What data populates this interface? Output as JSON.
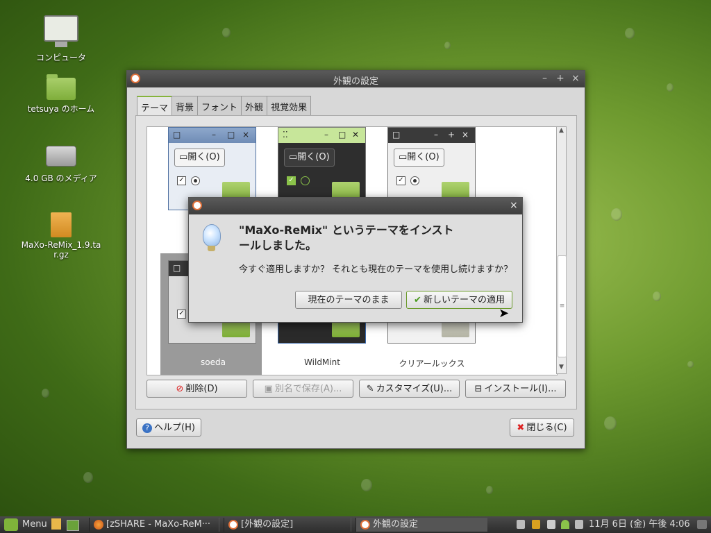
{
  "desktop": {
    "icons": [
      {
        "label": "コンピュータ"
      },
      {
        "label": "tetsuya のホーム"
      },
      {
        "label": "4.0 GB のメディア"
      },
      {
        "label": "MaXo-ReMix_1.9.tar.gz"
      }
    ]
  },
  "window": {
    "title": "外観の設定",
    "controls": {
      "minimize": "–",
      "maximize": "+",
      "close": "×"
    },
    "tabs": [
      "テーマ",
      "背景",
      "フォント",
      "外観",
      "視覚効果"
    ],
    "themes": [
      {
        "name": "",
        "open_label": "開く(O)"
      },
      {
        "name": "",
        "open_label": "開く(O)"
      },
      {
        "name": "",
        "open_label": "開く(O)"
      },
      {
        "name": "soeda"
      },
      {
        "name": "WildMint"
      },
      {
        "name": "クリアールックス"
      }
    ],
    "buttons": {
      "delete": "削除(D)",
      "save_as": "別名で保存(A)...",
      "customize": "カスタマイズ(U)...",
      "install": "インストール(I)...",
      "help": "ヘルプ(H)",
      "close": "閉じる(C)"
    }
  },
  "dialog": {
    "close": "×",
    "heading": "\"MaXo-ReMix\" というテーマをインストールしました。",
    "message": "今すぐ適用しますか？ それとも現在のテーマを使用し続けますか？",
    "keep_button": "現在のテーマのまま",
    "apply_button": "新しいテーマの適用"
  },
  "taskbar": {
    "menu_label": "Menu",
    "tasks": [
      {
        "label": "[zSHARE - MaXo-ReM···"
      },
      {
        "label": "[外観の設定]"
      },
      {
        "label": "外観の設定"
      }
    ],
    "clock": "11月 6日 (金) 午後 4:06"
  }
}
